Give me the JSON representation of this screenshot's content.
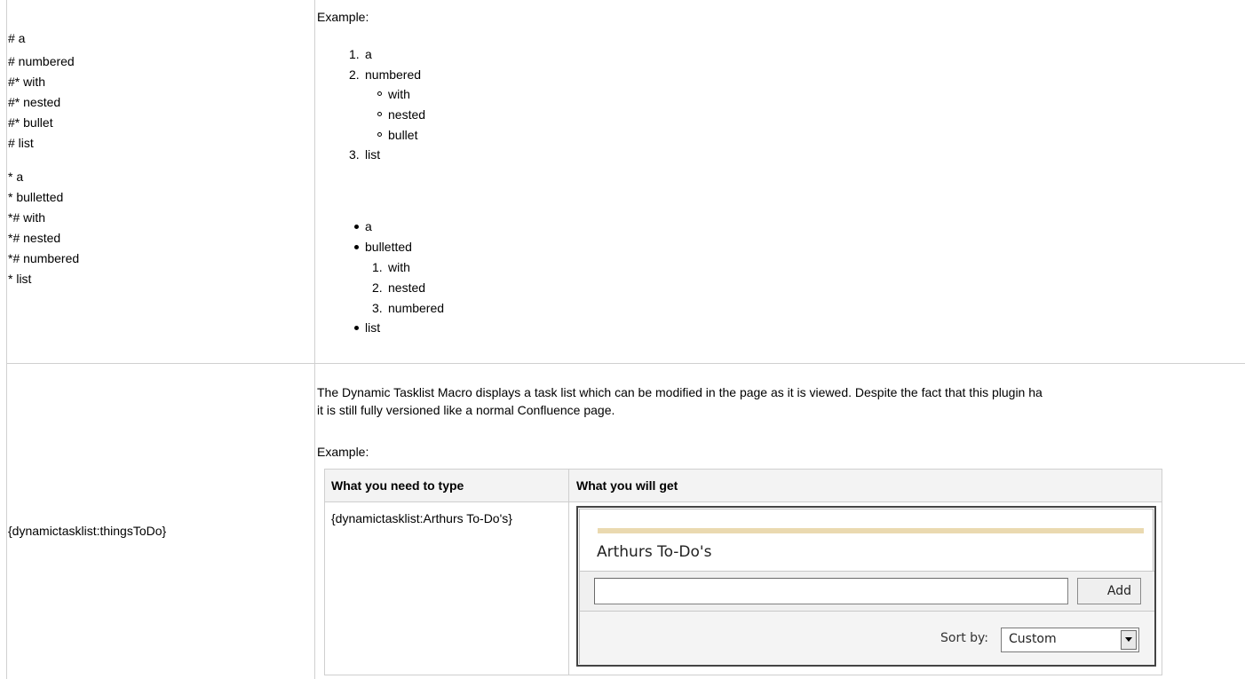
{
  "row1": {
    "markup_lines": [
      "# a",
      "# numbered",
      "#* with",
      "#* nested",
      "#* bullet",
      "# list",
      "* a",
      "* bulletted",
      "*# with",
      "*# nested",
      "*# numbered",
      "* list"
    ],
    "example_label": "Example:",
    "numbered": [
      {
        "num": "1.",
        "text": "a"
      },
      {
        "num": "2.",
        "text": "numbered"
      },
      {
        "num": "3.",
        "text": "list"
      }
    ],
    "nested_bullets": [
      "with",
      "nested",
      "bullet"
    ],
    "bulleted": [
      "a",
      "bulletted",
      "list"
    ],
    "nested_numbered": [
      {
        "num": "1.",
        "text": "with"
      },
      {
        "num": "2.",
        "text": "nested"
      },
      {
        "num": "3.",
        "text": "numbered"
      }
    ]
  },
  "row2": {
    "markup": "{dynamictasklist:thingsToDo}",
    "description_line1": "The Dynamic Tasklist Macro displays a task list which can be modified in the page as it is viewed. Despite the fact that this plugin ha",
    "description_line2": "it is still fully versioned like a normal Confluence page.",
    "example_label": "Example:",
    "table": {
      "col1_header": "What you need to type",
      "col2_header": "What you will get",
      "cell_markup": "{dynamictasklist:Arthurs To-Do's}"
    },
    "tasklist": {
      "title": "Arthurs To-Do's",
      "input_value": "",
      "add_label": "Add",
      "sort_label": "Sort by:",
      "sort_value": "Custom"
    }
  }
}
